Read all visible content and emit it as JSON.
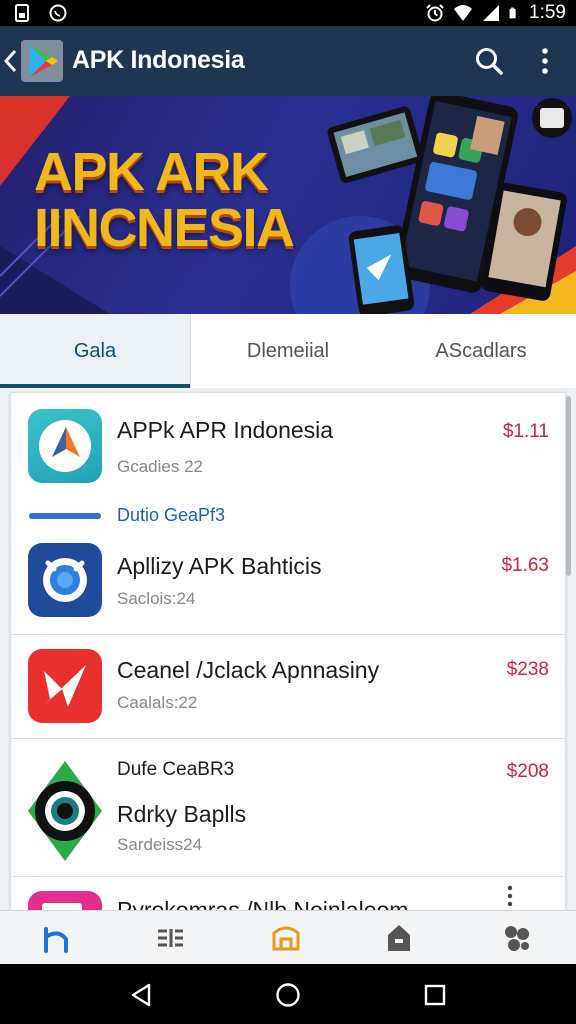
{
  "status_bar": {
    "time": "1:59",
    "icons": [
      "sim-card-icon",
      "whatsapp-icon",
      "alarm-icon",
      "wifi-icon",
      "signal-icon",
      "battery-icon"
    ]
  },
  "app_bar": {
    "title": "APK Indonesia",
    "icons": [
      "back-icon",
      "play-store-logo",
      "search-icon",
      "more-vert-icon"
    ]
  },
  "banner": {
    "headline_line1": "APK ARK",
    "headline_line2": "IINCNESIA",
    "colors": {
      "headline": "#f0b81c",
      "background": "#2a2f92"
    }
  },
  "tabs": [
    {
      "label": "Gala",
      "active": true
    },
    {
      "label": "Dlemeiial",
      "active": false
    },
    {
      "label": "AScadlars",
      "active": false
    }
  ],
  "list": {
    "section_link": "Dutio GeaPf3",
    "items": [
      {
        "title": "APPk APR Indonesia",
        "subtitle": "Gcadies 22",
        "price": "$1.11",
        "icon": "orange-arrow-app-icon"
      },
      {
        "title": "Apllizy APK Bahticis",
        "subtitle": "Saclois:24",
        "price": "$1.63",
        "icon": "blue-lens-app-icon"
      },
      {
        "title": "Ceanel /Jclack Apnnasiny",
        "subtitle": "Caalals:22",
        "price": "$238",
        "icon": "red-plane-app-icon"
      },
      {
        "category": "Dufe CeaBR3",
        "title": "Rdrky Baplls",
        "subtitle": "Sardeiss24",
        "price": "$208",
        "icon": "green-eye-app-icon"
      },
      {
        "title": "Pyrokomras /Nlb Noinlaleom",
        "icon": "pink-app-icon"
      }
    ]
  },
  "bottom_nav": {
    "items": [
      "home-icon",
      "list-icon",
      "store-icon",
      "bag-icon",
      "settings-icon"
    ],
    "active_color": "#1e73d8"
  },
  "system_nav": [
    "back-triangle-icon",
    "home-circle-icon",
    "recents-square-icon"
  ],
  "colors": {
    "app_bar": "#1f3550",
    "accent": "#14506e",
    "price": "#d2243e"
  }
}
